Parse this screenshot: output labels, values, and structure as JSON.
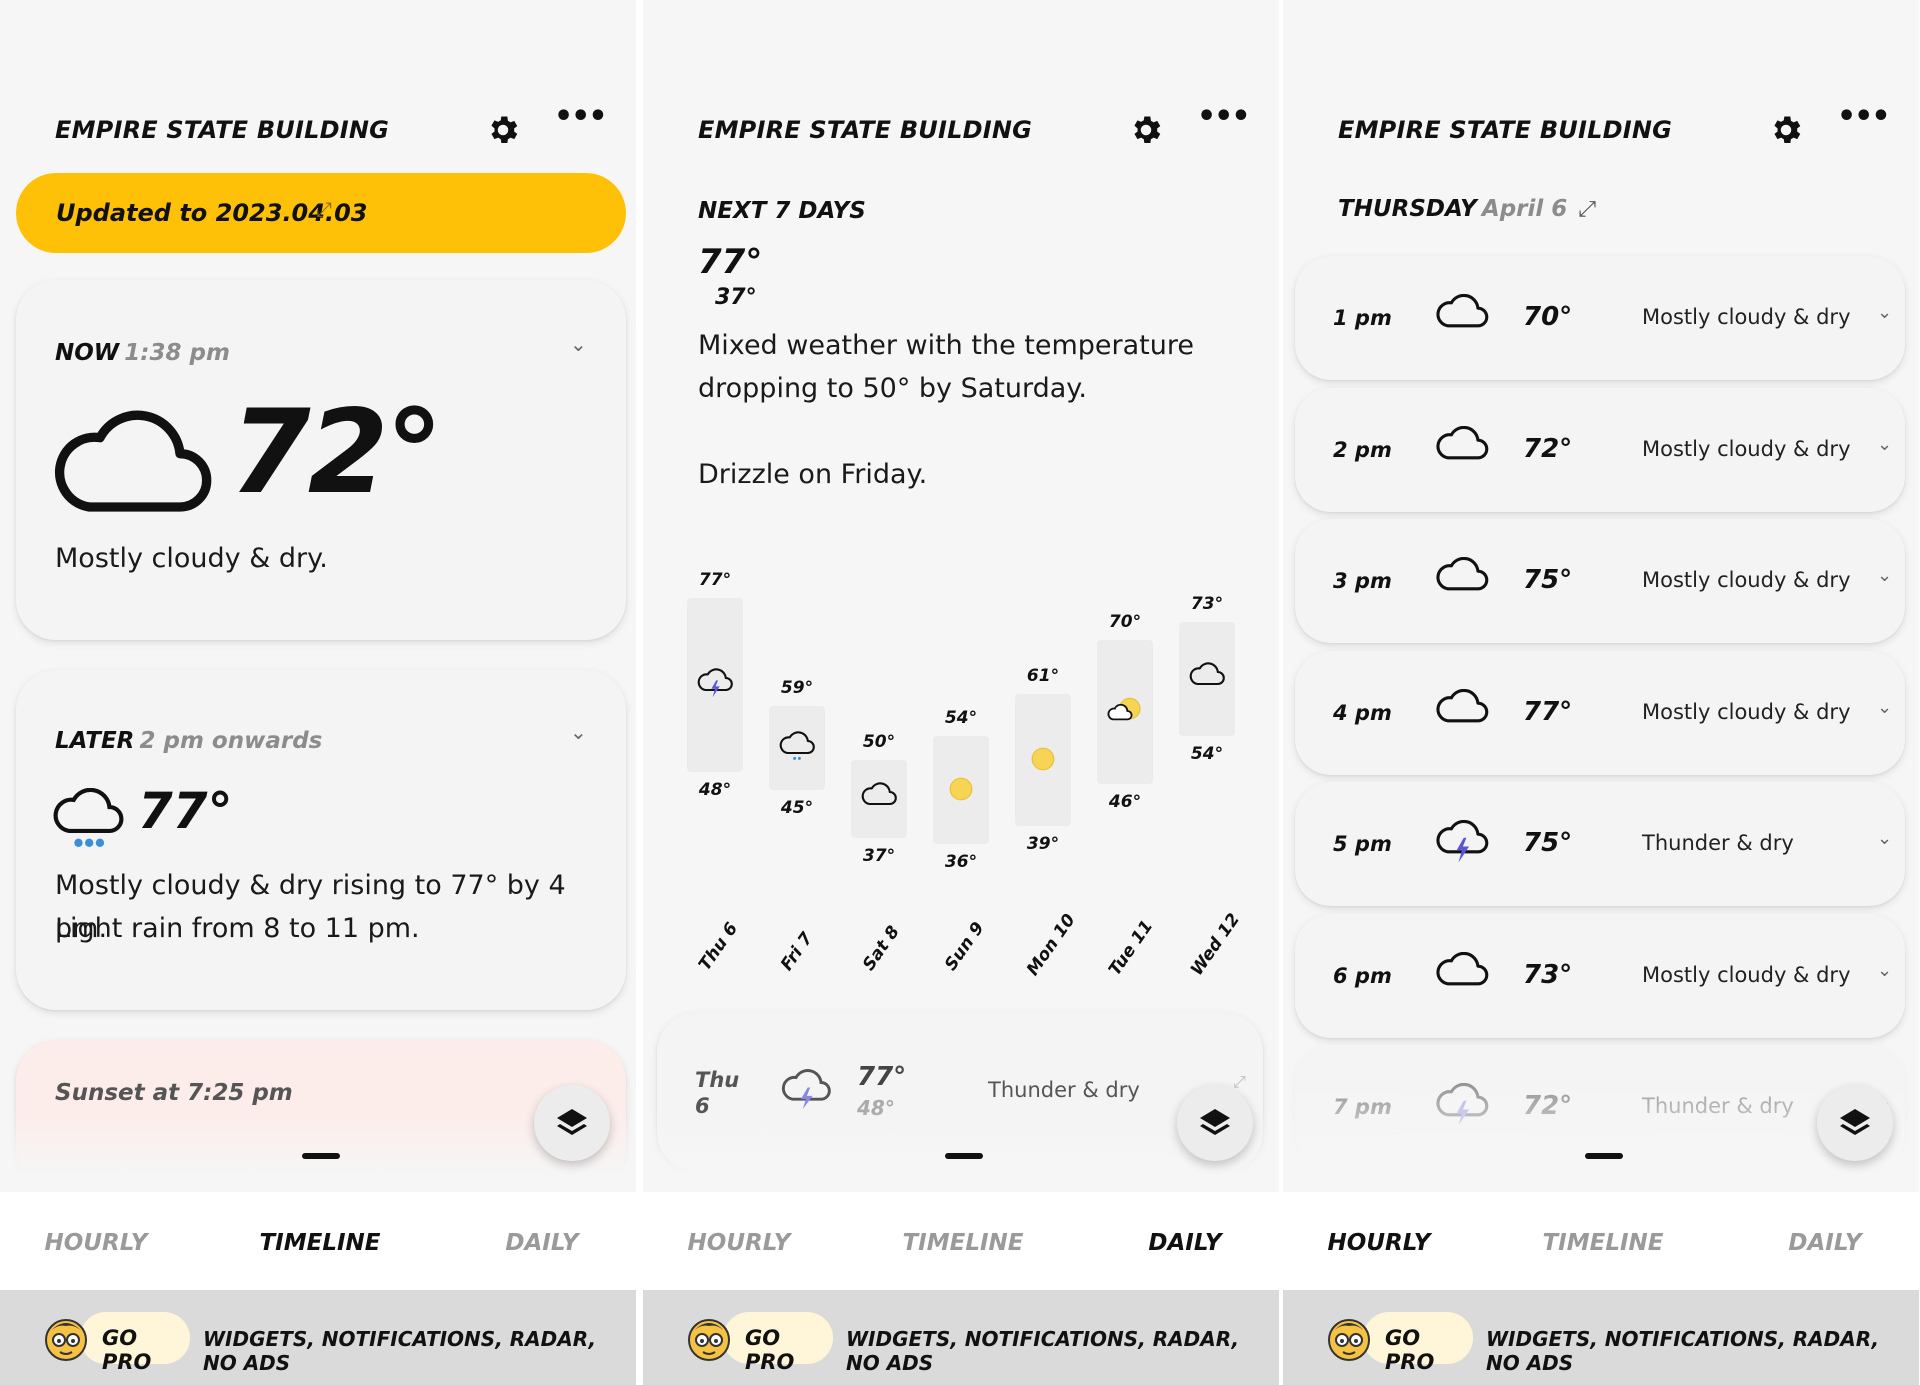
{
  "location": "EMPIRE STATE BUILDING",
  "icons": {
    "settings": "gear-icon",
    "more": "ellipsis-icon",
    "layers": "layers-icon",
    "expand": "expand-icon",
    "chevron": "chevron-down-icon"
  },
  "colors": {
    "banner": "#ffc107",
    "sun": "#f7d454",
    "thunder": "#5a56d6",
    "rain": "#3b8fd8"
  },
  "tabs": [
    "HOURLY",
    "TIMELINE",
    "DAILY"
  ],
  "pro": {
    "button": "GO PRO",
    "features": "WIDGETS, NOTIFICATIONS, RADAR, NO ADS"
  },
  "timeline": {
    "banner": "Updated to 2023.04.03",
    "now": {
      "label": "NOW",
      "time": "1:38 pm",
      "temp": "72°",
      "desc": "Mostly cloudy & dry."
    },
    "later": {
      "label": "LATER",
      "time": "2 pm onwards",
      "temp": "77°",
      "desc_line1": "Mostly cloudy & dry rising to 77° by 4 pm.",
      "desc_line2": "Light rain from 8 to 11 pm."
    },
    "sunset": "Sunset at 7:25 pm",
    "active_tab": 1
  },
  "daily": {
    "heading": "NEXT 7 DAYS",
    "high": "77°",
    "low": "37°",
    "summary_line1": "Mixed weather with the temperature",
    "summary_line2": "dropping to 50° by Saturday.",
    "summary_line3": "Drizzle on Friday.",
    "active_tab": 2,
    "first_row": {
      "day": "Thu",
      "date": "6",
      "high": "77°",
      "low": "48°",
      "desc": "Thunder & dry"
    },
    "chart_data": {
      "type": "bar",
      "categories": [
        "Thu 6",
        "Fri 7",
        "Sat 8",
        "Sun 9",
        "Mon 10",
        "Tue 11",
        "Wed 12"
      ],
      "series": [
        {
          "name": "high",
          "values": [
            77,
            59,
            50,
            54,
            61,
            70,
            73
          ]
        },
        {
          "name": "low",
          "values": [
            48,
            45,
            37,
            36,
            39,
            46,
            54
          ]
        }
      ],
      "high_labels": [
        "77°",
        "59°",
        "50°",
        "54°",
        "61°",
        "70°",
        "73°"
      ],
      "low_labels": [
        "48°",
        "45°",
        "37°",
        "36°",
        "39°",
        "46°",
        "54°"
      ],
      "icons": [
        "thunder-cloud",
        "drizzle-cloud",
        "cloud",
        "sun",
        "sun",
        "sun-cloud",
        "cloud"
      ]
    }
  },
  "hourly": {
    "day": "THURSDAY",
    "date": "April 6",
    "active_tab": 0,
    "rows": [
      {
        "time": "1 pm",
        "icon": "cloud",
        "temp": "70°",
        "desc": "Mostly cloudy & dry"
      },
      {
        "time": "2 pm",
        "icon": "cloud",
        "temp": "72°",
        "desc": "Mostly cloudy & dry"
      },
      {
        "time": "3 pm",
        "icon": "cloud",
        "temp": "75°",
        "desc": "Mostly cloudy & dry"
      },
      {
        "time": "4 pm",
        "icon": "cloud",
        "temp": "77°",
        "desc": "Mostly cloudy & dry"
      },
      {
        "time": "5 pm",
        "icon": "thunder-cloud",
        "temp": "75°",
        "desc": "Thunder & dry"
      },
      {
        "time": "6 pm",
        "icon": "cloud",
        "temp": "73°",
        "desc": "Mostly cloudy & dry"
      },
      {
        "time": "7 pm",
        "icon": "thunder-cloud",
        "temp": "72°",
        "desc": "Thunder & dry"
      }
    ]
  }
}
